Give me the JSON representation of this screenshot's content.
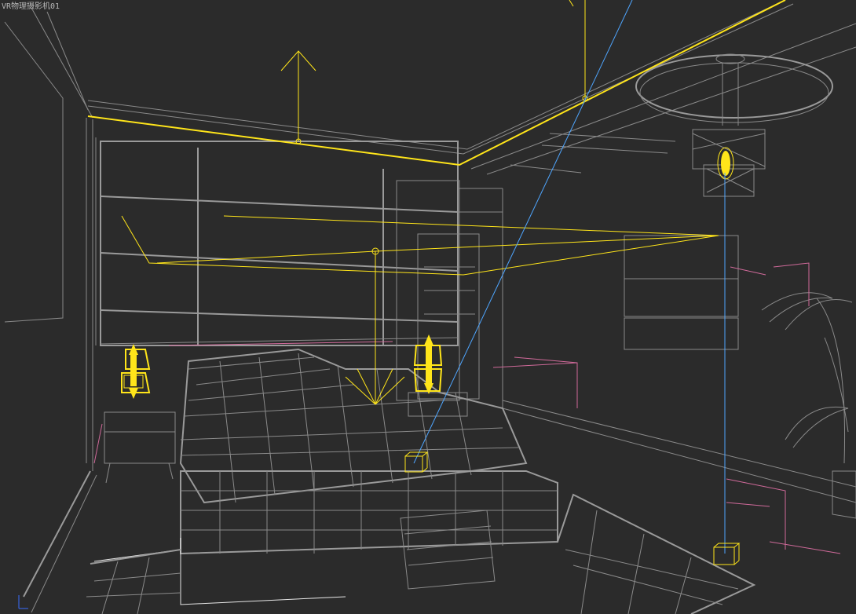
{
  "viewport": {
    "label": "VR物理摄影机01",
    "colors": {
      "background": "#2b2b2b",
      "wireframe": "#8a8a8a",
      "selected_light": "#ffe51a",
      "camera_target_line": "#4fa6ff",
      "helper_lines": "#d06a9a"
    }
  }
}
